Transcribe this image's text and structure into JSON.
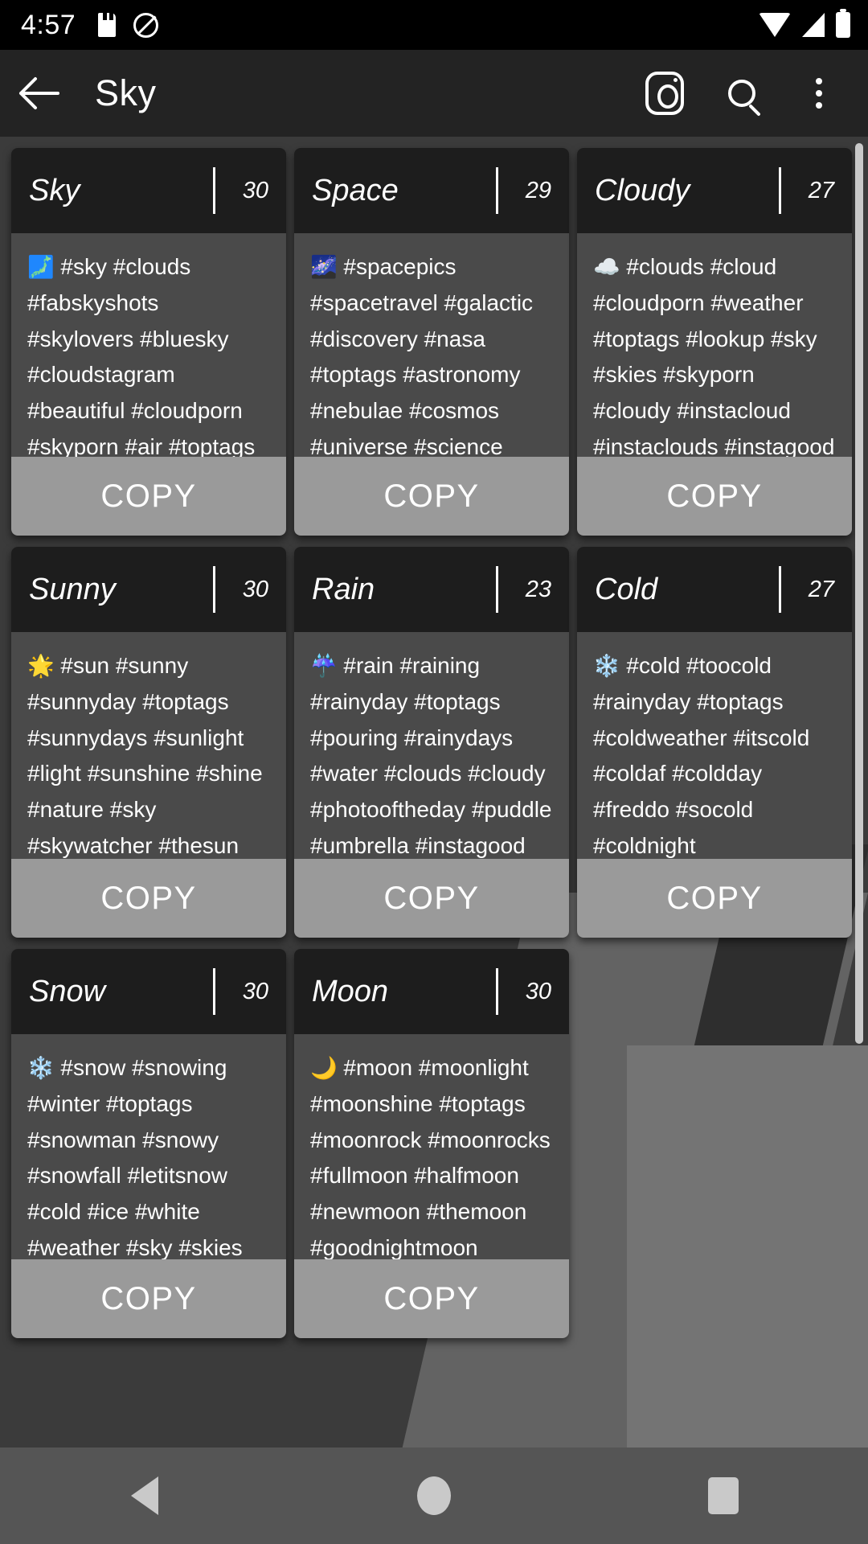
{
  "status_bar": {
    "clock": "4:57",
    "icons_left": [
      "sd-card-icon",
      "no-silence-icon"
    ],
    "icons_right": [
      "wifi-icon",
      "cellular-signal-icon",
      "battery-icon"
    ]
  },
  "app_bar": {
    "back_icon": "back-arrow-icon",
    "title": "Sky",
    "actions": [
      {
        "name": "instagram-icon",
        "label": "Instagram"
      },
      {
        "name": "search-icon",
        "label": "Search"
      },
      {
        "name": "overflow-menu-icon",
        "label": "More options"
      }
    ]
  },
  "copy_label": "COPY",
  "cards": [
    {
      "title": "Sky",
      "count": "30",
      "emoji": "🗾",
      "tags": "#sky #clouds #fabskyshots #skylovers #bluesky #cloudstagram #beautiful #cloudporn #skyporn #air #toptags #blue #white #ic_skies #beauty #global_sky #skysnappers #skieshunter #igworldsky #thebestskyever #iskyhub …"
    },
    {
      "title": "Space",
      "count": "29",
      "emoji": "🌌",
      "tags": "#spacepics #spacetravel #galactic #discovery #nasa #toptags #astronomy #nebulae #cosmos #universe #science #constellation #universe #spacetime #outerspace #space #nightsky #galaxy #nasabeyond #deepsky #…"
    },
    {
      "title": "Cloudy",
      "count": "27",
      "emoji": "☁️",
      "tags": "#clouds #cloud #cloudporn #weather #toptags #lookup #sky #skies #skyporn #cloudy #instacloud #instaclouds #instagood #nature #beautiful #gloomy #skyline #horizon #overcast #instasky #epicsky #crazyclouds #p…"
    },
    {
      "title": "Sunny",
      "count": "30",
      "emoji": "🌟",
      "tags": "#sun #sunny #sunnyday #toptags #sunnydays #sunlight #light #sunshine #shine #nature #sky #skywatcher #thesun #sunrays #photooftheday #beautiful #beautifulday #weather #summer #goodday #goodweather #instasunny #instasun #in…"
    },
    {
      "title": "Rain",
      "count": "23",
      "emoji": "☔",
      "tags": "#rain #raining #rainyday #toptags #pouring #rainydays #water #clouds #cloudy #photooftheday #puddle #umbrella #instagood #gloomy #rainyweather #rainydayz #splash #downpour #instarain #sky #moment #amazing #instadaily"
    },
    {
      "title": "Cold",
      "count": "27",
      "emoji": "❄️",
      "tags": "#cold #toocold #rainyday #toptags #coldweather #itscold #coldaf #coldday #freddo #socold #coldnight #coldmornings #imcold #verycold #instalike #instalikes #instacold #supercold #gettingcold #feelingcold #freezing #t…"
    },
    {
      "title": "Snow",
      "count": "30",
      "emoji": "❄️",
      "tags": "#snow #snowing #winter #toptags #snowman #snowy #snowfall #letitsnow #cold #ice #white #weather #sky #skies #frosty #frost #chilly #nature #snowflakes #instagood #wintertime #winterwonderland #whiteworld #joy #instawi…"
    },
    {
      "title": "Moon",
      "count": "30",
      "emoji": "🌙",
      "tags": "#moon #moonlight #moonshine #toptags #moonrock #moonrocks #fullmoon #halfmoon #newmoon #themoon #goodnightmoon #mooney #sky #skies #moonphases #moonlovers #moonrise #nature #instamoon #ig_moon #nightsky #luna…"
    }
  ],
  "nav_bar": {
    "items": [
      {
        "name": "nav-back-icon",
        "label": "Back"
      },
      {
        "name": "nav-home-icon",
        "label": "Home"
      },
      {
        "name": "nav-recents-icon",
        "label": "Recents"
      }
    ]
  },
  "colors": {
    "status_bar_bg": "#000000",
    "app_bar_bg": "#232323",
    "card_header_bg": "#1d1d1d",
    "card_body_bg": "#4a4a4a",
    "copy_button_bg": "#9a9a9a",
    "nav_bar_bg": "#555555",
    "page_bg": "#3b3b3b"
  }
}
